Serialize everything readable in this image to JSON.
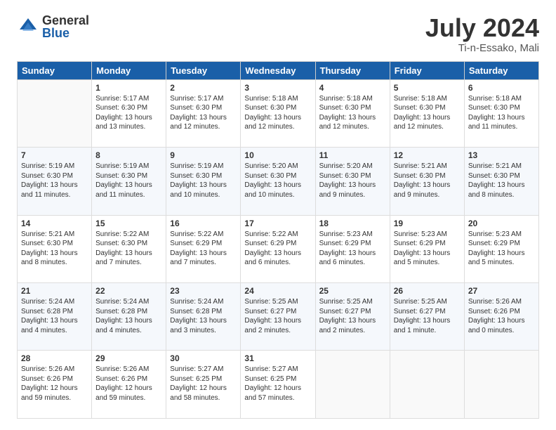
{
  "logo": {
    "general": "General",
    "blue": "Blue"
  },
  "title": "July 2024",
  "subtitle": "Ti-n-Essako, Mali",
  "headers": [
    "Sunday",
    "Monday",
    "Tuesday",
    "Wednesday",
    "Thursday",
    "Friday",
    "Saturday"
  ],
  "weeks": [
    [
      {
        "day": "",
        "info": ""
      },
      {
        "day": "1",
        "info": "Sunrise: 5:17 AM\nSunset: 6:30 PM\nDaylight: 13 hours\nand 13 minutes."
      },
      {
        "day": "2",
        "info": "Sunrise: 5:17 AM\nSunset: 6:30 PM\nDaylight: 13 hours\nand 12 minutes."
      },
      {
        "day": "3",
        "info": "Sunrise: 5:18 AM\nSunset: 6:30 PM\nDaylight: 13 hours\nand 12 minutes."
      },
      {
        "day": "4",
        "info": "Sunrise: 5:18 AM\nSunset: 6:30 PM\nDaylight: 13 hours\nand 12 minutes."
      },
      {
        "day": "5",
        "info": "Sunrise: 5:18 AM\nSunset: 6:30 PM\nDaylight: 13 hours\nand 12 minutes."
      },
      {
        "day": "6",
        "info": "Sunrise: 5:18 AM\nSunset: 6:30 PM\nDaylight: 13 hours\nand 11 minutes."
      }
    ],
    [
      {
        "day": "7",
        "info": "Sunrise: 5:19 AM\nSunset: 6:30 PM\nDaylight: 13 hours\nand 11 minutes."
      },
      {
        "day": "8",
        "info": "Sunrise: 5:19 AM\nSunset: 6:30 PM\nDaylight: 13 hours\nand 11 minutes."
      },
      {
        "day": "9",
        "info": "Sunrise: 5:19 AM\nSunset: 6:30 PM\nDaylight: 13 hours\nand 10 minutes."
      },
      {
        "day": "10",
        "info": "Sunrise: 5:20 AM\nSunset: 6:30 PM\nDaylight: 13 hours\nand 10 minutes."
      },
      {
        "day": "11",
        "info": "Sunrise: 5:20 AM\nSunset: 6:30 PM\nDaylight: 13 hours\nand 9 minutes."
      },
      {
        "day": "12",
        "info": "Sunrise: 5:21 AM\nSunset: 6:30 PM\nDaylight: 13 hours\nand 9 minutes."
      },
      {
        "day": "13",
        "info": "Sunrise: 5:21 AM\nSunset: 6:30 PM\nDaylight: 13 hours\nand 8 minutes."
      }
    ],
    [
      {
        "day": "14",
        "info": "Sunrise: 5:21 AM\nSunset: 6:30 PM\nDaylight: 13 hours\nand 8 minutes."
      },
      {
        "day": "15",
        "info": "Sunrise: 5:22 AM\nSunset: 6:30 PM\nDaylight: 13 hours\nand 7 minutes."
      },
      {
        "day": "16",
        "info": "Sunrise: 5:22 AM\nSunset: 6:29 PM\nDaylight: 13 hours\nand 7 minutes."
      },
      {
        "day": "17",
        "info": "Sunrise: 5:22 AM\nSunset: 6:29 PM\nDaylight: 13 hours\nand 6 minutes."
      },
      {
        "day": "18",
        "info": "Sunrise: 5:23 AM\nSunset: 6:29 PM\nDaylight: 13 hours\nand 6 minutes."
      },
      {
        "day": "19",
        "info": "Sunrise: 5:23 AM\nSunset: 6:29 PM\nDaylight: 13 hours\nand 5 minutes."
      },
      {
        "day": "20",
        "info": "Sunrise: 5:23 AM\nSunset: 6:29 PM\nDaylight: 13 hours\nand 5 minutes."
      }
    ],
    [
      {
        "day": "21",
        "info": "Sunrise: 5:24 AM\nSunset: 6:28 PM\nDaylight: 13 hours\nand 4 minutes."
      },
      {
        "day": "22",
        "info": "Sunrise: 5:24 AM\nSunset: 6:28 PM\nDaylight: 13 hours\nand 4 minutes."
      },
      {
        "day": "23",
        "info": "Sunrise: 5:24 AM\nSunset: 6:28 PM\nDaylight: 13 hours\nand 3 minutes."
      },
      {
        "day": "24",
        "info": "Sunrise: 5:25 AM\nSunset: 6:27 PM\nDaylight: 13 hours\nand 2 minutes."
      },
      {
        "day": "25",
        "info": "Sunrise: 5:25 AM\nSunset: 6:27 PM\nDaylight: 13 hours\nand 2 minutes."
      },
      {
        "day": "26",
        "info": "Sunrise: 5:25 AM\nSunset: 6:27 PM\nDaylight: 13 hours\nand 1 minute."
      },
      {
        "day": "27",
        "info": "Sunrise: 5:26 AM\nSunset: 6:26 PM\nDaylight: 13 hours\nand 0 minutes."
      }
    ],
    [
      {
        "day": "28",
        "info": "Sunrise: 5:26 AM\nSunset: 6:26 PM\nDaylight: 12 hours\nand 59 minutes."
      },
      {
        "day": "29",
        "info": "Sunrise: 5:26 AM\nSunset: 6:26 PM\nDaylight: 12 hours\nand 59 minutes."
      },
      {
        "day": "30",
        "info": "Sunrise: 5:27 AM\nSunset: 6:25 PM\nDaylight: 12 hours\nand 58 minutes."
      },
      {
        "day": "31",
        "info": "Sunrise: 5:27 AM\nSunset: 6:25 PM\nDaylight: 12 hours\nand 57 minutes."
      },
      {
        "day": "",
        "info": ""
      },
      {
        "day": "",
        "info": ""
      },
      {
        "day": "",
        "info": ""
      }
    ]
  ]
}
